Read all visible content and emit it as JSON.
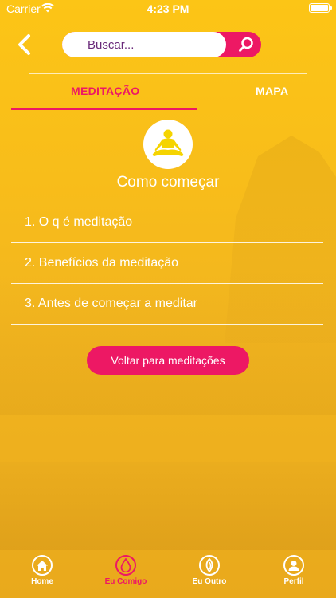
{
  "status_bar": {
    "carrier": "Carrier",
    "time": "4:23 PM"
  },
  "search": {
    "placeholder": "Buscar..."
  },
  "tabs": [
    {
      "label": "MEDITAÇÃO",
      "active": true
    },
    {
      "label": "MAPA",
      "active": false
    }
  ],
  "section": {
    "title": "Como começar",
    "icon": "meditation-pose-icon"
  },
  "topics": [
    "1. O q é meditação",
    "2. Benefícios da meditação",
    "3. Antes de começar a meditar"
  ],
  "back_button_label": "Voltar para meditações",
  "tab_bar": {
    "home": "Home",
    "eu_comigo": "Eu Comigo",
    "eu_outro": "Eu Outro",
    "perfil": "Perfil",
    "active": "Eu Comigo"
  },
  "colors": {
    "accent": "#ed1864",
    "background": "#f8bd1a",
    "text": "#ffffff",
    "meditation_icon": "#f5d400"
  }
}
